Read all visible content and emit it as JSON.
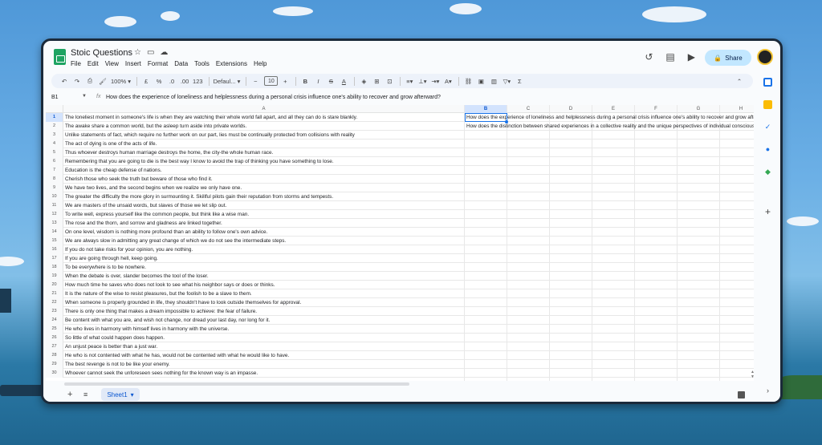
{
  "app": {
    "doc_title": "Stoic Questions",
    "menu": [
      "File",
      "Edit",
      "View",
      "Insert",
      "Format",
      "Data",
      "Tools",
      "Extensions",
      "Help"
    ],
    "share_label": "Share"
  },
  "toolbar": {
    "zoom": "100%",
    "currency": "£",
    "percent": "%",
    "dec_decrease": ".0",
    "dec_increase": ".00",
    "number_format": "123",
    "font": "Defaul...",
    "font_size": "10",
    "bold": "B",
    "italic": "I",
    "strike": "S",
    "text_color": "A"
  },
  "formula_bar": {
    "cell_ref": "B1",
    "fx": "fx",
    "content": "How does the experience of loneliness and helplessness during a personal crisis influence one's ability to recover and grow afterward?"
  },
  "columns": [
    "A",
    "B",
    "C",
    "D",
    "E",
    "F",
    "G",
    "H",
    "I"
  ],
  "selected_column": "B",
  "rows": [
    {
      "n": "1",
      "a": "The loneliest moment in someone's life is when they are watching their whole world fall apart, and all they can do is stare blankly.",
      "b": "How does the experience of loneliness and helplessness during a personal crisis influence one's ability to recover and grow afterwa"
    },
    {
      "n": "2",
      "a": "The awake share a common world, but the asleep turn aside into private worlds.",
      "b": "How does the distinction between shared experiences in a collective reality and the unique perspectives of individual consciousness"
    },
    {
      "n": "3",
      "a": "Unlike statements of fact, which require no further work on our part, lies must be continually protected from collisions with reality",
      "b": ""
    },
    {
      "n": "4",
      "a": "The act of dying is one of the acts of life.",
      "b": ""
    },
    {
      "n": "5",
      "a": "Thus whoever destroys human marriage destroys the home, the city-the whole human race.",
      "b": ""
    },
    {
      "n": "6",
      "a": "Remembering that you are going to die is the best way I know to avoid the trap of thinking you have something to lose.",
      "b": ""
    },
    {
      "n": "7",
      "a": "Education is the cheap defense of nations.",
      "b": ""
    },
    {
      "n": "8",
      "a": "Cherish those who seek the truth but beware of those who find it.",
      "b": ""
    },
    {
      "n": "9",
      "a": "We have two lives, and the second begins when we realize we only have one.",
      "b": ""
    },
    {
      "n": "10",
      "a": "The greater the difficulty the more glory in surmounting it. Skillful pilots gain their reputation from storms and tempests.",
      "b": ""
    },
    {
      "n": "11",
      "a": "We are masters of the unsaid words, but slaves of those we let slip out.",
      "b": ""
    },
    {
      "n": "12",
      "a": "To write well, express yourself like the common people, but think like a wise man.",
      "b": ""
    },
    {
      "n": "13",
      "a": "The rose and the thorn, and sorrow and gladness are linked together.",
      "b": ""
    },
    {
      "n": "14",
      "a": "On one level, wisdom is nothing more profound than an ability to follow one's own advice.",
      "b": ""
    },
    {
      "n": "15",
      "a": "We are always slow in admitting any great change of which we do not see the intermediate steps.",
      "b": ""
    },
    {
      "n": "16",
      "a": "If you do not take risks for your opinion, you are nothing.",
      "b": ""
    },
    {
      "n": "17",
      "a": "If you are going through hell, keep going.",
      "b": ""
    },
    {
      "n": "18",
      "a": "To be everywhere is to be nowhere.",
      "b": ""
    },
    {
      "n": "19",
      "a": "When the debate is over, slander becomes the tool of the loser.",
      "b": ""
    },
    {
      "n": "20",
      "a": "How much time he saves who does not look to see what his neighbor says or does or thinks.",
      "b": ""
    },
    {
      "n": "21",
      "a": "It is the nature of the wise to resist pleasures, but the foolish to be a slave to them.",
      "b": ""
    },
    {
      "n": "22",
      "a": "When someone is properly grounded in life, they shouldn't have to look outside themselves for approval.",
      "b": ""
    },
    {
      "n": "23",
      "a": "There is only one thing that makes a dream impossible to achieve: the fear of failure.",
      "b": ""
    },
    {
      "n": "24",
      "a": "Be content with what you are, and wish not change, nor dread your last day, nor long for it.",
      "b": ""
    },
    {
      "n": "25",
      "a": "He who lives in harmony with himself lives in harmony with the universe.",
      "b": ""
    },
    {
      "n": "26",
      "a": "So little of what could happen does happen.",
      "b": ""
    },
    {
      "n": "27",
      "a": "An unjust peace is better than a just war.",
      "b": ""
    },
    {
      "n": "28",
      "a": "He who is not contented with what he has, would not be contented with what he would like to have.",
      "b": ""
    },
    {
      "n": "29",
      "a": "The best revenge is not to be like your enemy.",
      "b": ""
    },
    {
      "n": "30",
      "a": "Whoever cannot seek the unforeseen sees nothing for the known way is an impasse.",
      "b": ""
    }
  ],
  "sheet_tab": "Sheet1",
  "colors": {
    "selection": "#1a73e8",
    "share_bg": "#c2e7ff",
    "sheets_green": "#1ea362"
  }
}
